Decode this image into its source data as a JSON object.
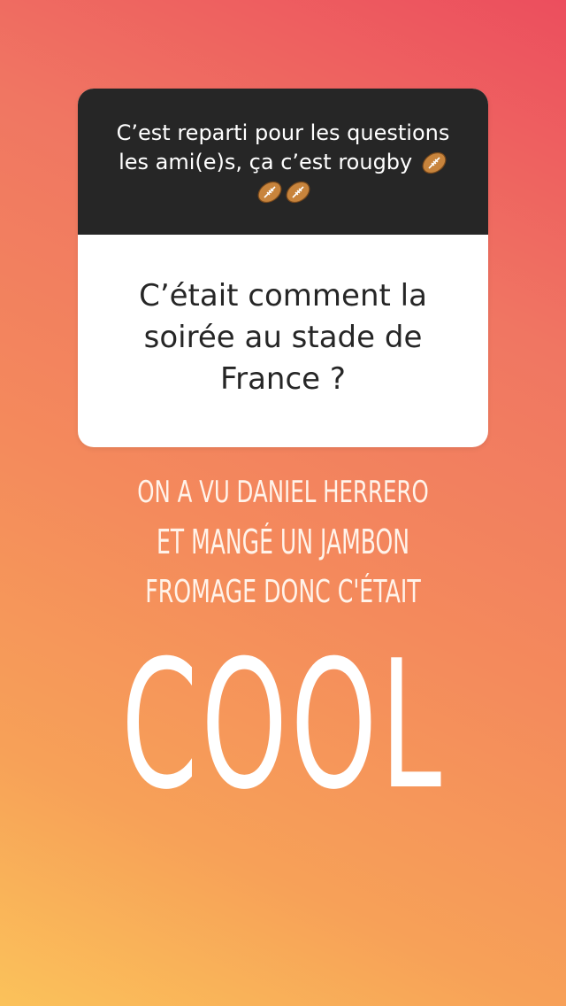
{
  "story": {
    "background_colors": [
      "#ec4e5e",
      "#f48a5c",
      "#fbc25a"
    ],
    "question_sticker": {
      "prompt": "C’est reparti pour les questions les ami(e)s, ça c’est rougby",
      "prompt_icons": [
        "rugby-ball-icon",
        "rugby-ball-icon",
        "rugby-ball-icon"
      ],
      "question": "C’était comment la soirée au stade de France ?"
    },
    "answer_lines": [
      "ON A VU DANIEL HERRERO",
      "ET MANGÉ UN JAMBON",
      "FROMAGE DONC C'ÉTAIT"
    ],
    "big_word": "COOL"
  }
}
